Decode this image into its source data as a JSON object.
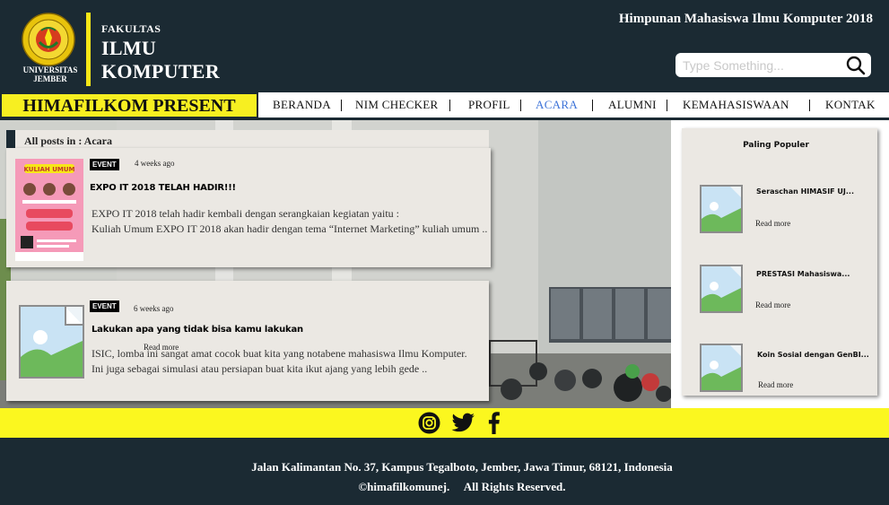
{
  "header": {
    "logo_caption_line1": "UNIVERSITAS",
    "logo_caption_line2": "JEMBER",
    "faculty_small": "FAKULTAS",
    "faculty_line1": "ILMU",
    "faculty_line2": "KOMPUTER",
    "organization": "Himpunan Mahasiswa Ilmu Komputer 2018",
    "search_placeholder": "Type Something..."
  },
  "nav": {
    "brand": "HIMAFILKOM PRESENT",
    "items": [
      "BERANDA",
      "NIM CHECKER",
      "PROFIL",
      "ACARA",
      "ALUMNI",
      "KEMAHASISWAAN",
      "KONTAK"
    ],
    "active": "ACARA"
  },
  "breadcrumb": "All posts in : Acara",
  "posts": [
    {
      "category": "EVENT",
      "time": "4 weeks ago",
      "title": "EXPO IT 2018 TELAH HADIR!!!",
      "excerpt_line1": "EXPO IT 2018 telah hadir kembali dengan serangkaian kegiatan yaitu :",
      "excerpt_line2": "Kuliah Umum EXPO IT 2018 akan hadir dengan tema “Internet Marketing”  kuliah umum ..",
      "poster_text": "KULIAH UMUM"
    },
    {
      "category": "EVENT",
      "time": "6 weeks ago",
      "title": "Lakukan apa yang tidak bisa kamu lakukan",
      "read_more": "Read more",
      "excerpt_line1": "ISIC, lomba ini sangat amat cocok buat kita yang notabene mahasiswa Ilmu Komputer.",
      "excerpt_line2": "Ini juga sebagai simulasi atau persiapan buat kita ikut ajang yang lebih gede .."
    }
  ],
  "popular": {
    "title": "Paling Populer",
    "items": [
      {
        "name": "Seraschan HIMASIF UJ...",
        "read_more": "Read more"
      },
      {
        "name": "PRESTASI Mahasiswa...",
        "read_more": "Read more"
      },
      {
        "name": "Koin Sosial dengan GenBI...",
        "read_more": "Read more"
      }
    ]
  },
  "social": [
    "instagram-icon",
    "twitter-icon",
    "facebook-icon"
  ],
  "footer": {
    "address": "Jalan Kalimantan No. 37, Kampus Tegalboto, Jember, Jawa Timur, 68121, Indonesia",
    "copyright": "©himafilkomunej.     All Rights Reserved."
  },
  "colors": {
    "dark": "#1b2a33",
    "yellow": "#f7ef21",
    "card": "#ebe8e3",
    "active_link": "#3d73d8"
  }
}
